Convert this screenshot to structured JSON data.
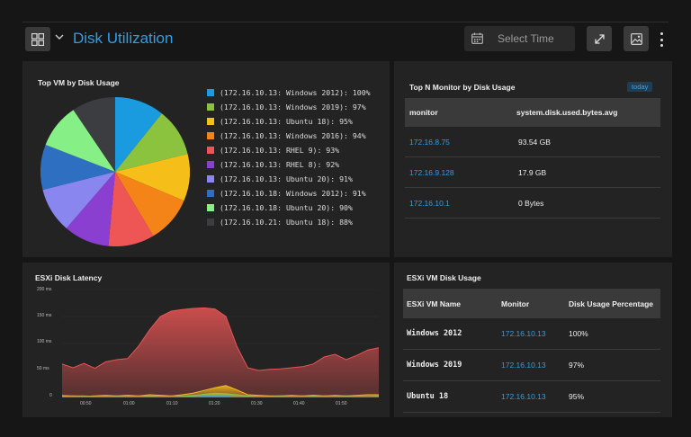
{
  "header": {
    "title": "Disk Utilization",
    "time_placeholder": "Select Time"
  },
  "pie_panel": {
    "title": "Top VM by Disk Usage",
    "legend": [
      {
        "label": "(172.16.10.13: Windows 2012): 100%",
        "color": "#1a9be0",
        "value": 100
      },
      {
        "label": "(172.16.10.13: Windows 2019): 97%",
        "color": "#8bc33f",
        "value": 97
      },
      {
        "label": "(172.16.10.13: Ubuntu 18): 95%",
        "color": "#f5be18",
        "value": 95
      },
      {
        "label": "(172.16.10.13: Windows 2016): 94%",
        "color": "#f58418",
        "value": 94
      },
      {
        "label": "(172.16.10.13: RHEL 9): 93%",
        "color": "#ee5656",
        "value": 93
      },
      {
        "label": "(172.16.10.13: RHEL 8): 92%",
        "color": "#8a3fd1",
        "value": 92
      },
      {
        "label": "(172.16.10.13: Ubuntu 20): 91%",
        "color": "#8a86f0",
        "value": 91
      },
      {
        "label": "(172.16.10.18: Windows 2012): 91%",
        "color": "#2f6fc2",
        "value": 91
      },
      {
        "label": "(172.16.10.18: Ubuntu 20): 90%",
        "color": "#86ef86",
        "value": 90
      },
      {
        "label": "(172.16.10.21: Ubuntu 18): 88%",
        "color": "#3c3d40",
        "value": 88
      }
    ]
  },
  "topn_panel": {
    "title": "Top N Monitor by Disk Usage",
    "badge": "today",
    "columns": [
      "monitor",
      "system.disk.used.bytes.avg"
    ],
    "rows": [
      {
        "monitor": "172.16.8.75",
        "value": "93.54 GB"
      },
      {
        "monitor": "172.16.9.128",
        "value": "17.9 GB"
      },
      {
        "monitor": "172.16.10.1",
        "value": "0 Bytes"
      }
    ]
  },
  "latency_panel": {
    "title": "ESXi Disk Latency",
    "y_ticks": [
      "200 ms",
      "150 ms",
      "100 ms",
      "50 ms",
      "0"
    ],
    "x_ticks": [
      "00:50",
      "01:00",
      "01:10",
      "01:20",
      "01:30",
      "01:40",
      "01:50"
    ]
  },
  "chart_data": {
    "type": "area",
    "title": "ESXi Disk Latency",
    "ylim": [
      0,
      200
    ],
    "y_unit": "ms",
    "x": [
      "00:45",
      "00:47",
      "00:50",
      "00:52",
      "00:55",
      "00:57",
      "01:00",
      "01:02",
      "01:05",
      "01:07",
      "01:10",
      "01:12",
      "01:15",
      "01:17",
      "01:20",
      "01:22",
      "01:25",
      "01:27",
      "01:30",
      "01:32",
      "01:35",
      "01:37",
      "01:40",
      "01:42",
      "01:45",
      "01:47",
      "01:50",
      "01:52",
      "01:55",
      "01:57"
    ],
    "series": [
      {
        "color": "#e85454",
        "values": [
          62,
          55,
          63,
          54,
          66,
          70,
          72,
          95,
          125,
          150,
          160,
          163,
          165,
          166,
          164,
          150,
          95,
          55,
          50,
          52,
          53,
          55,
          57,
          62,
          75,
          80,
          70,
          78,
          88,
          92
        ]
      },
      {
        "color": "#f5be18",
        "values": [
          2,
          3,
          2,
          3,
          4,
          3,
          4,
          3,
          5,
          4,
          3,
          5,
          8,
          13,
          18,
          22,
          14,
          5,
          4,
          3,
          3,
          4,
          3,
          4,
          3,
          4,
          3,
          4,
          5,
          5
        ]
      },
      {
        "color": "#f58418",
        "values": [
          4,
          3,
          3,
          2,
          3,
          3,
          2,
          3,
          3,
          2,
          3,
          3,
          4,
          5,
          7,
          6,
          5,
          3,
          3,
          2,
          3,
          3,
          3,
          2,
          3,
          3,
          3,
          3,
          4,
          4
        ]
      },
      {
        "color": "#8bc33f",
        "values": [
          1,
          1,
          2,
          1,
          1,
          2,
          1,
          1,
          2,
          1,
          1,
          2,
          3,
          6,
          8,
          7,
          5,
          2,
          1,
          1,
          2,
          1,
          1,
          2,
          1,
          1,
          2,
          1,
          1,
          2
        ]
      },
      {
        "color": "#2f9fe6",
        "values": [
          1,
          1,
          1,
          1,
          1,
          1,
          1,
          1,
          1,
          1,
          1,
          1,
          1,
          2,
          2,
          2,
          1,
          1,
          1,
          1,
          1,
          1,
          1,
          1,
          1,
          1,
          1,
          1,
          1,
          1
        ]
      }
    ]
  },
  "vm_panel": {
    "title": "ESXi VM Disk Usage",
    "columns": [
      "ESXi VM Name",
      "Monitor",
      "Disk Usage Percentage"
    ],
    "rows": [
      {
        "name": "Windows 2012",
        "monitor": "172.16.10.13",
        "pct": "100%"
      },
      {
        "name": "Windows 2019",
        "monitor": "172.16.10.13",
        "pct": "97%"
      },
      {
        "name": "Ubuntu 18",
        "monitor": "172.16.10.13",
        "pct": "95%"
      }
    ]
  }
}
